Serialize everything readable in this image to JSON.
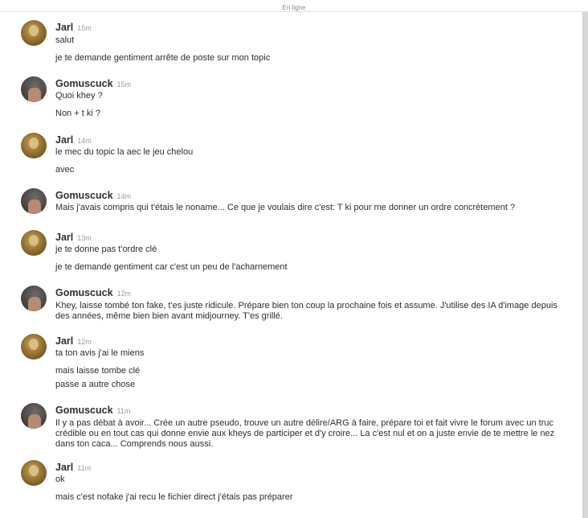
{
  "header": {
    "status": "En ligne"
  },
  "messages": [
    {
      "author": "Jarl",
      "time": "15m",
      "lines": [
        "salut",
        "je te demande gentiment arrête de poste sur mon topic"
      ]
    },
    {
      "author": "Gomuscuck",
      "time": "15m",
      "lines": [
        "Quoi khey ?",
        "Non + t ki ?"
      ]
    },
    {
      "author": "Jarl",
      "time": "14m",
      "lines": [
        "le mec du topic la aec le jeu chelou",
        "avec"
      ]
    },
    {
      "author": "Gomuscuck",
      "time": "14m",
      "lines": [
        "Mais j'avais compris qui t'étais le noname... Ce que je voulais dire c'est: T ki pour me donner un ordre concrètement ?"
      ]
    },
    {
      "author": "Jarl",
      "time": "13m",
      "lines": [
        "je te donne pas t'ordre clé",
        "je te demande gentiment car c'est un peu de l'acharnement"
      ]
    },
    {
      "author": "Gomuscuck",
      "time": "12m",
      "lines": [
        "Khey, laisse tombé ton fake, t'es juste ridicule. Prépare bien ton coup la prochaine fois et assume. J'utilise des IA d'image depuis des années, même bien bien avant midjourney. T'es grillé."
      ]
    },
    {
      "author": "Jarl",
      "time": "12m",
      "lines": [
        "ta ton avis j'ai le miens",
        "mais laisse tombe clé",
        "passe a autre chose"
      ]
    },
    {
      "author": "Gomuscuck",
      "time": "11m",
      "lines": [
        "Il y a pas débat à avoir... Crée un autre pseudo, trouve un autre délire/ARG à faire, prépare toi et fait vivre le forum avec un truc crédible ou en tout cas qui donne envie aux kheys de participer et d'y croire... La c'est nul et on a juste envie de te mettre le nez dans ton caca... Comprends nous aussi."
      ]
    },
    {
      "author": "Jarl",
      "time": "11m",
      "lines": [
        "ok",
        "mais c'est nofake j'ai recu le fichier direct j'étais pas préparer"
      ]
    }
  ]
}
